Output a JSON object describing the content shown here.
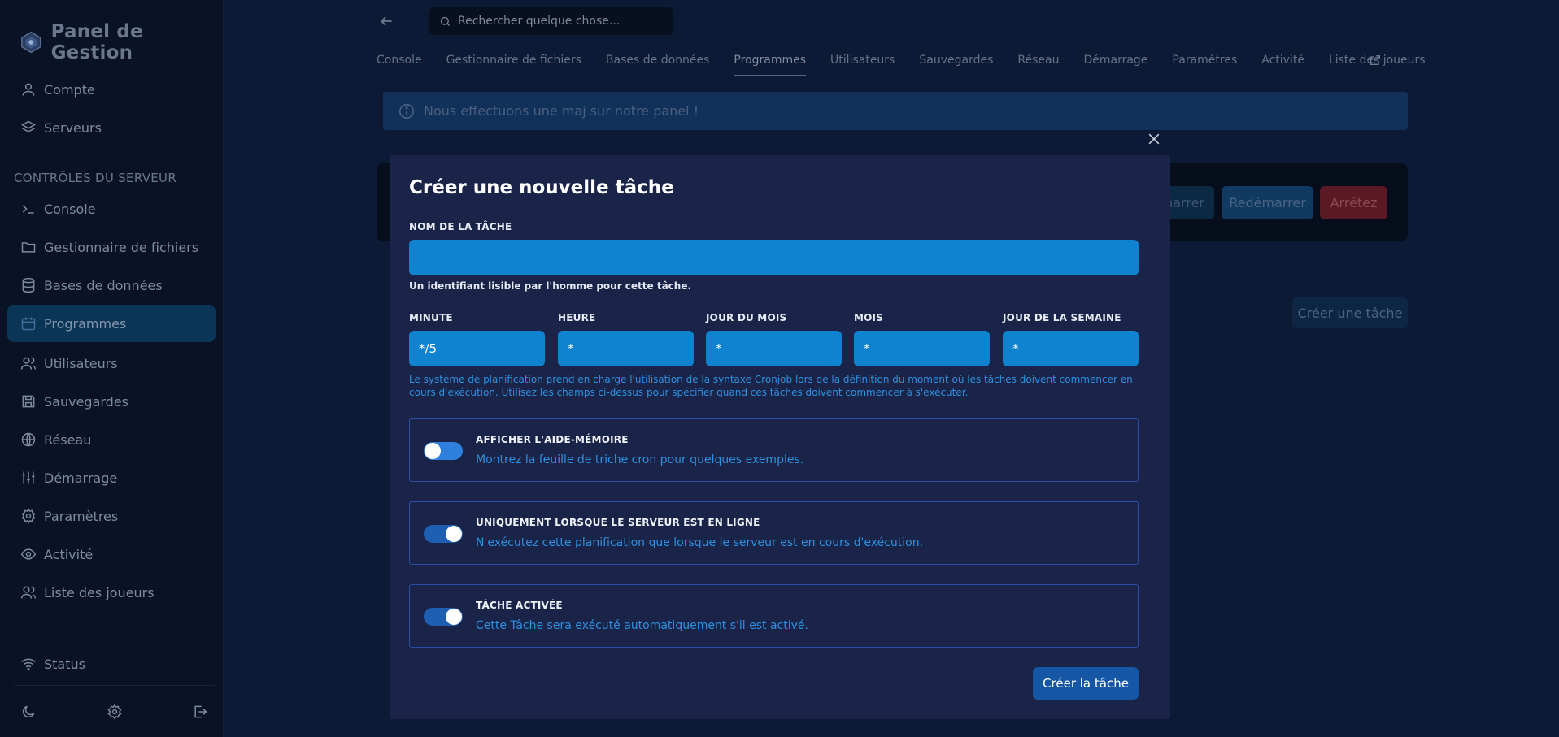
{
  "sidebar": {
    "brand": "Panel de Gestion",
    "top_items": [
      {
        "label": "Compte",
        "icon": "user-icon"
      },
      {
        "label": "Serveurs",
        "icon": "layers-icon"
      }
    ],
    "section_title": "CONTRÔLES DU SERVEUR",
    "server_items": [
      {
        "label": "Console",
        "icon": "terminal-icon"
      },
      {
        "label": "Gestionnaire de fichiers",
        "icon": "folder-icon"
      },
      {
        "label": "Bases de données",
        "icon": "database-icon"
      },
      {
        "label": "Programmes",
        "icon": "calendar-icon"
      },
      {
        "label": "Utilisateurs",
        "icon": "users-icon"
      },
      {
        "label": "Sauvegardes",
        "icon": "save-icon"
      },
      {
        "label": "Réseau",
        "icon": "globe-icon"
      },
      {
        "label": "Démarrage",
        "icon": "sliders-icon"
      },
      {
        "label": "Paramètres",
        "icon": "gear-icon"
      },
      {
        "label": "Activité",
        "icon": "eye-icon"
      },
      {
        "label": "Liste des joueurs",
        "icon": "users-icon"
      }
    ],
    "status_label": "Status"
  },
  "header": {
    "search_placeholder": "Rechercher quelque chose...",
    "tabs": [
      "Console",
      "Gestionnaire de fichiers",
      "Bases de données",
      "Programmes",
      "Utilisateurs",
      "Sauvegardes",
      "Réseau",
      "Démarrage",
      "Paramètres",
      "Activité",
      "Liste des joueurs"
    ],
    "active_tab": "Programmes"
  },
  "banner": {
    "text": "Nous effectuons une maj sur notre panel !"
  },
  "power": {
    "start": "marrer",
    "restart": "Redémarrer",
    "stop": "Arrêtez"
  },
  "create_task_button": "Créer une tâche",
  "modal": {
    "title": "Créer une nouvelle tâche",
    "name_label": "NOM DE LA TÂCHE",
    "name_value": "",
    "name_help": "Un identifiant lisible par l'homme pour cette tâche.",
    "cron": {
      "minute_label": "MINUTE",
      "minute_value": "*/5",
      "hour_label": "HEURE",
      "hour_value": "*",
      "dom_label": "JOUR DU MOIS",
      "dom_value": "*",
      "month_label": "MOIS",
      "month_value": "*",
      "dow_label": "JOUR DE LA SEMAINE",
      "dow_value": "*"
    },
    "cron_help": "Le système de planification prend en charge l'utilisation de la syntaxe Cronjob lors de la définition du moment où les tâches doivent commencer en cours d'exécution. Utilisez les champs ci-dessus pour spécifier quand ces tâches doivent commencer à s'exécuter.",
    "toggles": [
      {
        "title": "AFFICHER L'AIDE-MÉMOIRE",
        "description": "Montrez la feuille de triche cron pour quelques exemples.",
        "on": false
      },
      {
        "title": "UNIQUEMENT LORSQUE LE SERVEUR EST EN LIGNE",
        "description": "N'exécutez cette planification que lorsque le serveur est en cours d'exécution.",
        "on": true
      },
      {
        "title": "TÂCHE ACTIVÉE",
        "description": "Cette Tâche sera exécuté automatiquement s'il est activé.",
        "on": true
      }
    ],
    "submit": "Créer la tâche"
  },
  "colors": {
    "accent": "#1083d0",
    "modal_bg": "#1a2448",
    "toggle_border": "#2b4ea5",
    "danger": "#5a1a25"
  }
}
